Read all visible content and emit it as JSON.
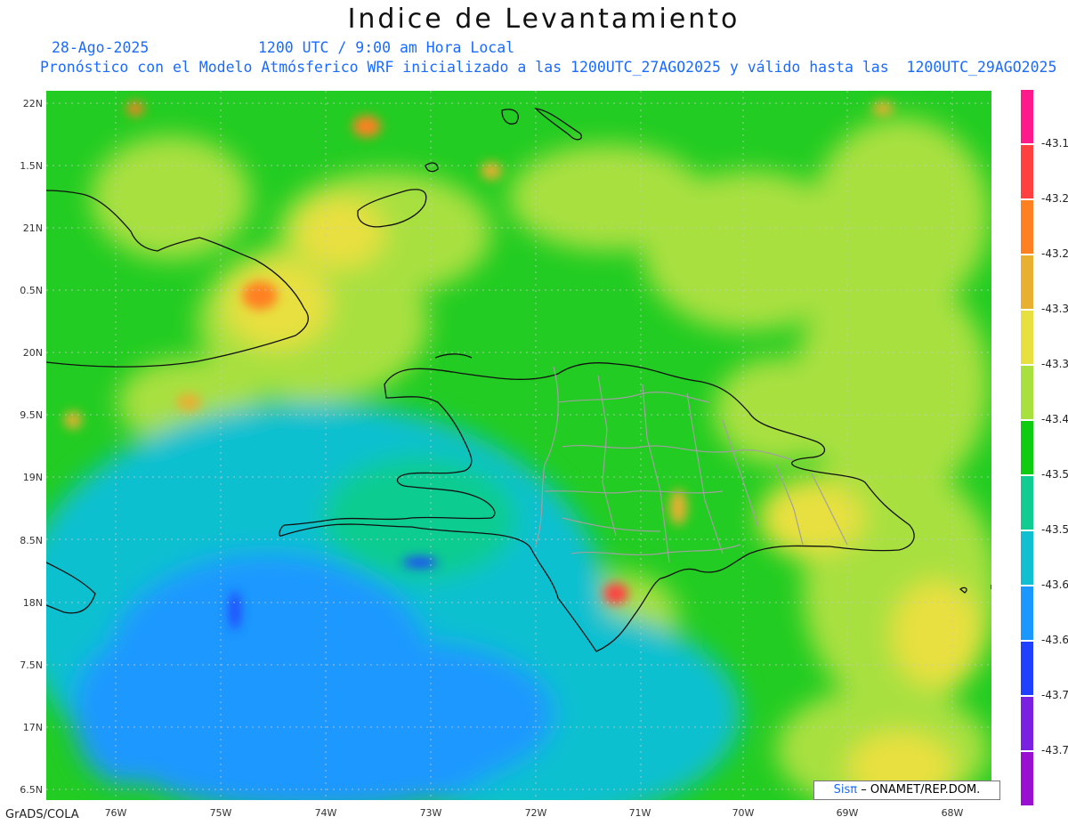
{
  "title": "Indice de Levantamiento",
  "date": "28-Ago-2025",
  "time": "1200 UTC / 9:00 am Hora Local",
  "forecast": "Pronóstico con el Modelo Atmósferico WRF inicializado a las 1200UTC_27AGO2025 y válido hasta las  1200UTC_29AGO2025",
  "lat_labels": [
    "22N",
    "1.5N",
    "21N",
    "0.5N",
    "20N",
    "9.5N",
    "19N",
    "8.5N",
    "18N",
    "7.5N",
    "17N",
    "6.5N"
  ],
  "lon_labels": [
    "76W",
    "75W",
    "74W",
    "73W",
    "72W",
    "71W",
    "70W",
    "69W",
    "68W"
  ],
  "legend": {
    "labels": [
      "-43.1",
      "-43.2",
      "-43.2",
      "-43.3",
      "-43.3",
      "-43.4",
      "-43.5",
      "-43.5",
      "-43.6",
      "-43.6",
      "-43.7",
      "-43.7"
    ],
    "colors": [
      "#ff1a8c",
      "#ff4040",
      "#ff8020",
      "#e8b030",
      "#e8e040",
      "#a8e040",
      "#10cc10",
      "#10cc90",
      "#10c0d0",
      "#1a98ff",
      "#2040ff",
      "#7a20e0",
      "#9a10d0"
    ]
  },
  "credit": {
    "logo": "Sisπ",
    "text": "– ONAMET/REP.DOM."
  },
  "footer": "GrADS/COLA"
}
